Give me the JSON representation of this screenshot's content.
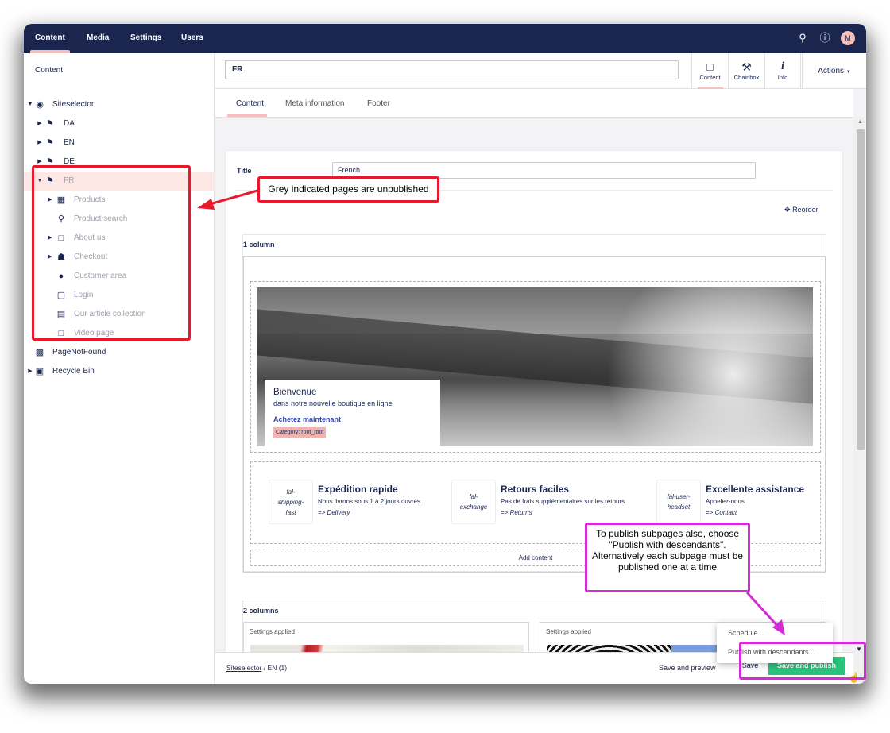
{
  "topnav": {
    "items": [
      "Content",
      "Media",
      "Settings",
      "Users"
    ],
    "avatar_initial": "M"
  },
  "sidebar": {
    "header": "Content",
    "tree": [
      {
        "label": "Siteselector",
        "icon": "globe-icon"
      },
      {
        "label": "DA",
        "icon": "flag-icon"
      },
      {
        "label": "EN",
        "icon": "flag-icon"
      },
      {
        "label": "DE",
        "icon": "flag-icon"
      },
      {
        "label": "FR",
        "icon": "flag-icon"
      },
      {
        "label": "Products",
        "icon": "grid-icon"
      },
      {
        "label": "Product search",
        "icon": "search-icon"
      },
      {
        "label": "About us",
        "icon": "document-icon"
      },
      {
        "label": "Checkout",
        "icon": "cart-icon"
      },
      {
        "label": "Customer area",
        "icon": "user-icon"
      },
      {
        "label": "Login",
        "icon": "unlock-icon"
      },
      {
        "label": "Our article collection",
        "icon": "document-list-icon"
      },
      {
        "label": "Video page",
        "icon": "document-icon"
      },
      {
        "label": "PageNotFound",
        "icon": "error-page-icon"
      },
      {
        "label": "Recycle Bin",
        "icon": "trash-icon"
      }
    ]
  },
  "editor": {
    "node_name": "FR",
    "apps": [
      {
        "label": "Content",
        "icon": "document-icon"
      },
      {
        "label": "Chainbox",
        "icon": "wrench-icon"
      },
      {
        "label": "Info",
        "icon": "info-icon"
      }
    ],
    "actions_label": "Actions",
    "tabs": [
      "Content",
      "Meta information",
      "Footer"
    ],
    "title_label": "Title",
    "title_value": "French",
    "reorder_label": "Reorder",
    "section1_title": "1 column",
    "hero": {
      "title": "Bienvenue",
      "subtitle": "dans notre nouvelle boutique en ligne",
      "link": "Achetez maintenant",
      "category": "Category: root_root"
    },
    "features": [
      {
        "icon": "fal-shipping-fast",
        "title": "Expédition rapide",
        "sub": "Nous livrons sous 1 à 2 jours ouvrés",
        "link": "=> Delivery"
      },
      {
        "icon": "fal-exchange",
        "title": "Retours faciles",
        "sub": "Pas de frais supplémentaires sur les retours",
        "link": "=> Returns"
      },
      {
        "icon": "fal-user-headset",
        "title": "Excellente assistance",
        "sub": "Appelez-nous",
        "link": "=> Contact"
      }
    ],
    "add_content": "Add content",
    "section2_title": "2 columns",
    "settings_applied": "Settings applied"
  },
  "footer": {
    "crumb_root": "Siteselector",
    "crumb_sep": "/",
    "crumb_current": "EN (1)",
    "save_preview": "Save and preview",
    "save": "Save",
    "save_publish": "Save and publish"
  },
  "publish_menu": {
    "items": [
      "Schedule...",
      "Publish with descendants..."
    ]
  },
  "annotations": {
    "unpublished_note": "Grey indicated pages are unpublished",
    "descendants_note": "To publish subpages also, choose \"Publish with descendants\". Alternatively each subpage must be published one at a time"
  },
  "colors": {
    "topbar": "#1b264f",
    "accent": "#f5c1bc",
    "publish_green": "#2bc37c",
    "callout_red": "#e8192c",
    "callout_pink": "#d42bd6"
  }
}
